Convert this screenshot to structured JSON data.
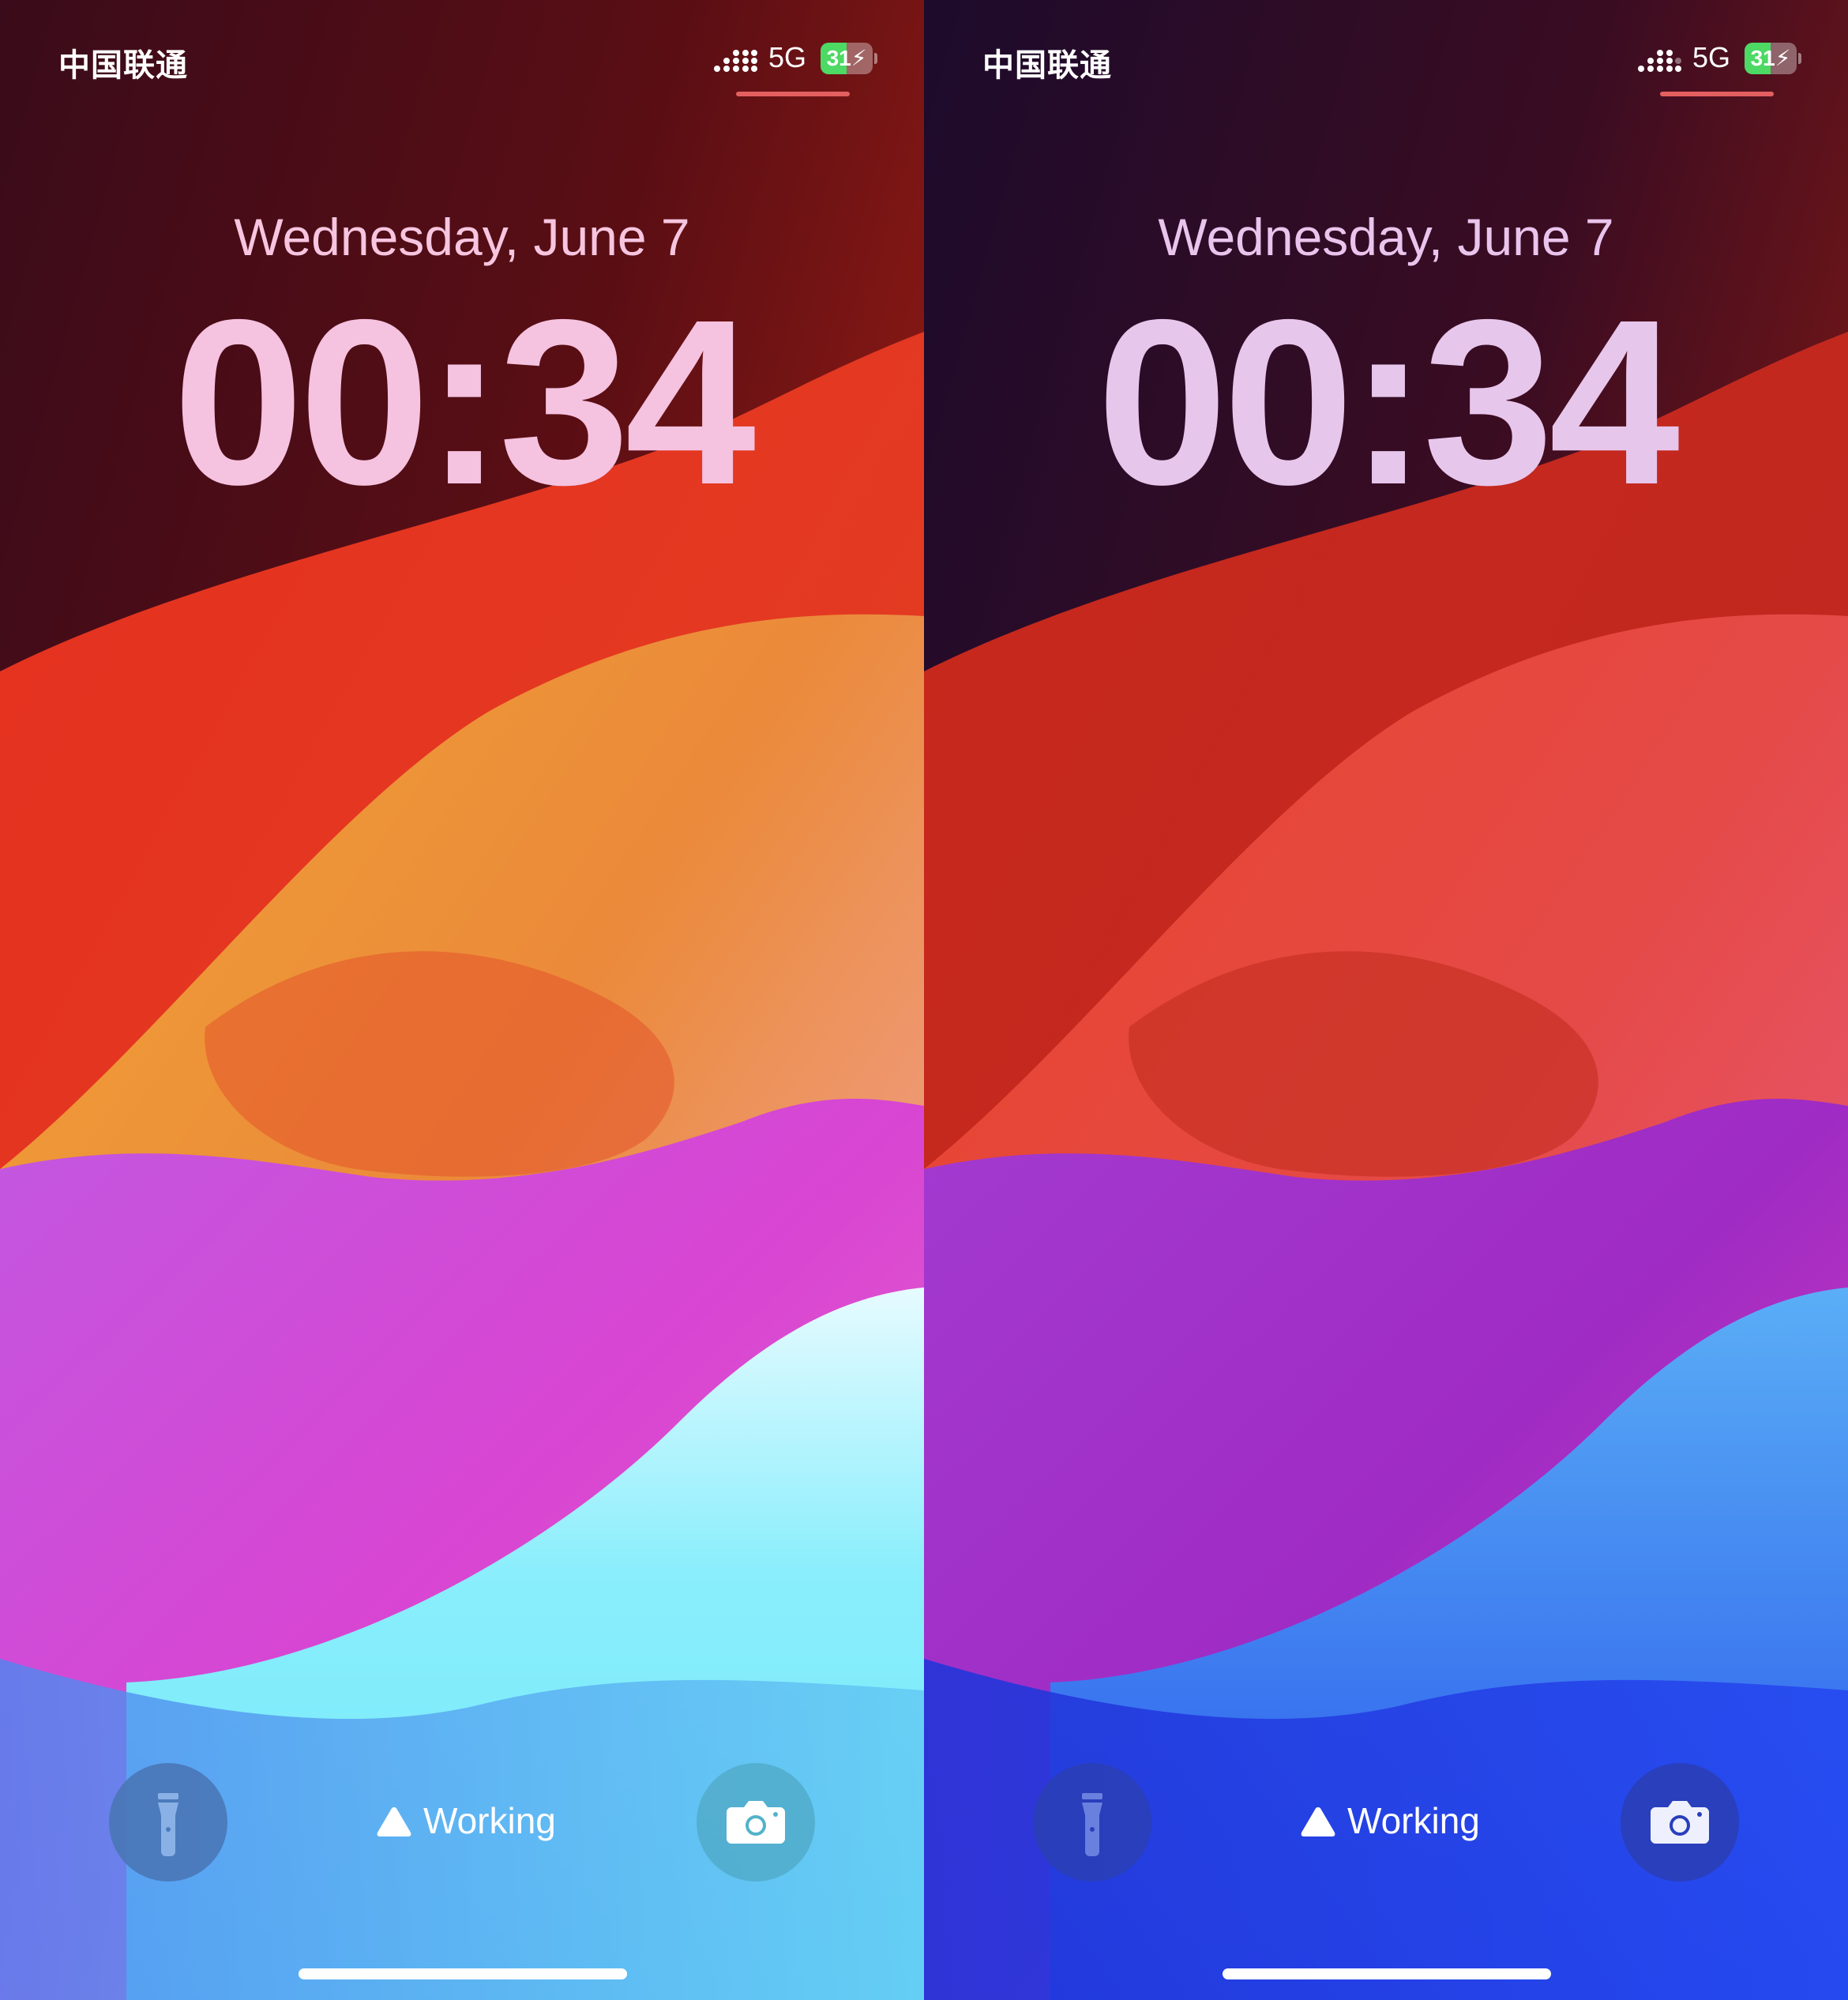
{
  "screens": [
    {
      "id": "light",
      "status_bar": {
        "carrier": "中国联通",
        "network": "5G",
        "battery_percent": "31",
        "battery_level": 0.31,
        "charging": true
      },
      "date": "Wednesday, June 7",
      "time": "00:34",
      "focus": {
        "label": "Working",
        "icon": "triangle-focus-icon"
      },
      "controls": {
        "flashlight_icon": "flashlight-icon",
        "camera_icon": "camera-icon"
      },
      "colors": {
        "date_text": "#f7c5df",
        "clock_text": "#f5c2e0",
        "button_bg": "#4a78b8",
        "indicator": "#e45f5f"
      }
    },
    {
      "id": "dark",
      "status_bar": {
        "carrier": "中国联通",
        "network": "5G",
        "battery_percent": "31",
        "battery_level": 0.31,
        "charging": true
      },
      "date": "Wednesday, June 7",
      "time": "00:34",
      "focus": {
        "label": "Working",
        "icon": "triangle-focus-icon"
      },
      "controls": {
        "flashlight_icon": "flashlight-icon",
        "camera_icon": "camera-icon"
      },
      "colors": {
        "date_text": "#e9c4ec",
        "clock_text": "#e7c6ec",
        "button_bg": "#2a3fb8",
        "indicator": "#e45f5f"
      }
    }
  ]
}
